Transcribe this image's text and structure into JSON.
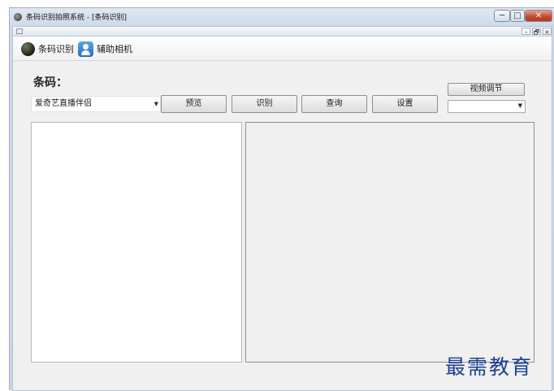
{
  "window": {
    "title": "条码识别拍照系统 - [条码识别]",
    "minimize": "─",
    "maximize": "□",
    "close": "✕"
  },
  "mdi": {
    "minimize": "–",
    "restore": "🗗",
    "close": "×"
  },
  "toolbar": {
    "barcode_label": "条码识别",
    "camera_label": "辅助相机"
  },
  "form": {
    "barcode_label": "条码：",
    "source_value": "爱奇艺直播伴侣",
    "dropdown_arrow": "▼",
    "preview_label": "预览",
    "recognize_label": "识别",
    "query_label": "查询",
    "settings_label": "设置",
    "video_adjust_label": "视频调节",
    "video_option_value": ""
  },
  "watermark": "最需教育"
}
